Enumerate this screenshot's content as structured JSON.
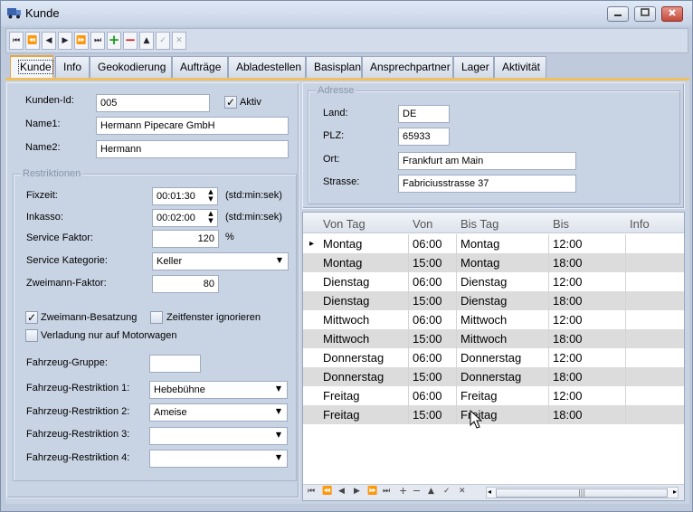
{
  "window": {
    "title": "Kunde"
  },
  "toolbar": {
    "buttons": [
      {
        "name": "first-record-button",
        "glyph": "⏮"
      },
      {
        "name": "prev-page-button",
        "glyph": "⏪"
      },
      {
        "name": "prev-record-button",
        "glyph": "◀"
      },
      {
        "name": "next-record-button",
        "glyph": "▶"
      },
      {
        "name": "next-page-button",
        "glyph": "⏩"
      },
      {
        "name": "last-record-button",
        "glyph": "⏭"
      },
      {
        "name": "add-record-button",
        "glyph": "+"
      },
      {
        "name": "delete-record-button",
        "glyph": "−"
      },
      {
        "name": "edit-record-button",
        "glyph": "▲"
      },
      {
        "name": "save-record-button",
        "glyph": "✓"
      },
      {
        "name": "cancel-record-button",
        "glyph": "✕"
      }
    ]
  },
  "tabs": [
    {
      "label": "Kunde"
    },
    {
      "label": "Info"
    },
    {
      "label": "Geokodierung"
    },
    {
      "label": "Aufträge"
    },
    {
      "label": "Abladestellen"
    },
    {
      "label": "Basisplan"
    },
    {
      "label": "Ansprechpartner"
    },
    {
      "label": "Lager"
    },
    {
      "label": "Aktivität"
    }
  ],
  "customer": {
    "id_label": "Kunden-Id:",
    "id_value": "005",
    "active_label": "Aktiv",
    "active_checked": true,
    "name1_label": "Name1:",
    "name1_value": "Hermann Pipecare GmbH",
    "name2_label": "Name2:",
    "name2_value": "Hermann"
  },
  "restrictions": {
    "title": "Restriktionen",
    "fixzeit_label": "Fixzeit:",
    "fixzeit_value": "00:01:30",
    "fixzeit_unit": "(std:min:sek)",
    "inkasso_label": "Inkasso:",
    "inkasso_value": "00:02:00",
    "inkasso_unit": "(std:min:sek)",
    "service_faktor_label": "Service Faktor:",
    "service_faktor_value": "120",
    "service_faktor_unit": "%",
    "service_kategorie_label": "Service Kategorie:",
    "service_kategorie_value": "Keller",
    "zweimann_faktor_label": "Zweimann-Faktor:",
    "zweimann_faktor_value": "80",
    "zweimann_besatzung_label": "Zweimann-Besatzung",
    "zweimann_besatzung_checked": true,
    "zeitfenster_label": "Zeitfenster ignorieren",
    "zeitfenster_checked": false,
    "motorwagen_label": "Verladung nur auf Motorwagen",
    "motorwagen_checked": false,
    "fahrzeug_gruppe_label": "Fahrzeug-Gruppe:",
    "fahrzeug_gruppe_value": "",
    "fr1_label": "Fahrzeug-Restriktion 1:",
    "fr1_value": "Hebebühne",
    "fr2_label": "Fahrzeug-Restriktion 2:",
    "fr2_value": "Ameise",
    "fr3_label": "Fahrzeug-Restriktion 3:",
    "fr3_value": "",
    "fr4_label": "Fahrzeug-Restriktion 4:",
    "fr4_value": ""
  },
  "address": {
    "title": "Adresse",
    "land_label": "Land:",
    "land_value": "DE",
    "plz_label": "PLZ:",
    "plz_value": "65933",
    "ort_label": "Ort:",
    "ort_value": "Frankfurt am Main",
    "strasse_label": "Strasse:",
    "strasse_value": "Fabriciusstrasse 37"
  },
  "schedule": {
    "columns": [
      "Von Tag",
      "Von",
      "Bis Tag",
      "Bis",
      "Info"
    ],
    "rows": [
      {
        "von_tag": "Montag",
        "von": "06:00",
        "bis_tag": "Montag",
        "bis": "12:00",
        "info": ""
      },
      {
        "von_tag": "Montag",
        "von": "15:00",
        "bis_tag": "Montag",
        "bis": "18:00",
        "info": ""
      },
      {
        "von_tag": "Dienstag",
        "von": "06:00",
        "bis_tag": "Dienstag",
        "bis": "12:00",
        "info": ""
      },
      {
        "von_tag": "Dienstag",
        "von": "15:00",
        "bis_tag": "Dienstag",
        "bis": "18:00",
        "info": ""
      },
      {
        "von_tag": "Mittwoch",
        "von": "06:00",
        "bis_tag": "Mittwoch",
        "bis": "12:00",
        "info": ""
      },
      {
        "von_tag": "Mittwoch",
        "von": "15:00",
        "bis_tag": "Mittwoch",
        "bis": "18:00",
        "info": ""
      },
      {
        "von_tag": "Donnerstag",
        "von": "06:00",
        "bis_tag": "Donnerstag",
        "bis": "12:00",
        "info": ""
      },
      {
        "von_tag": "Donnerstag",
        "von": "15:00",
        "bis_tag": "Donnerstag",
        "bis": "18:00",
        "info": ""
      },
      {
        "von_tag": "Freitag",
        "von": "06:00",
        "bis_tag": "Freitag",
        "bis": "12:00",
        "info": ""
      },
      {
        "von_tag": "Freitag",
        "von": "15:00",
        "bis_tag": "Freitag",
        "bis": "18:00",
        "info": ""
      }
    ],
    "current_row_indicator": "▸"
  },
  "colors": {
    "accent": "#f0c060",
    "close_button": "#c44b3b",
    "add_green": "#1a9a1a",
    "delete_red": "#cc2222"
  }
}
